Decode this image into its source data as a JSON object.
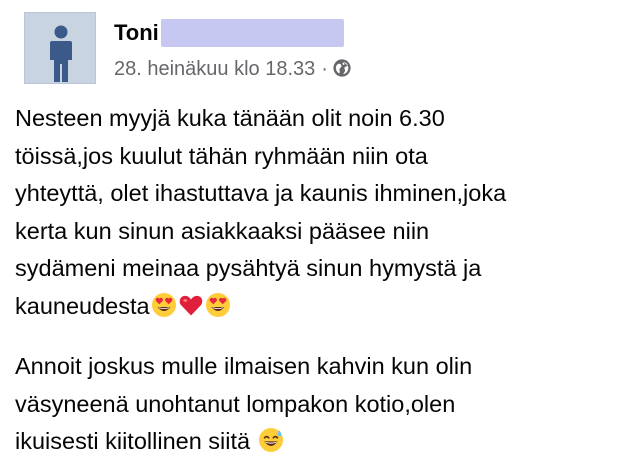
{
  "post": {
    "author_name": "Toni",
    "timestamp": "28. heinäkuu klo 18.33",
    "separator": "·",
    "audience_icon": "globe-icon",
    "paragraphs": [
      {
        "lines": [
          "Nesteen myyjä kuka tänään olit noin 6.30",
          "töissä,jos kuulut tähän ryhmään niin ota",
          "yhteyttä, olet ihastuttava ja kaunis ihminen,joka",
          "kerta kun sinun asiakkaaksi pääsee niin",
          "sydämeni meinaa pysähtyä sinun hymystä ja",
          "kauneudesta"
        ],
        "trailing_emoji": [
          "heart-eyes-emoji",
          "red-heart-emoji",
          "heart-eyes-emoji"
        ]
      },
      {
        "lines": [
          "Annoit joskus mulle ilmaisen kahvin kun olin",
          "väsyneenä unohtanut lompakon kotio,olen",
          "ikuisesti kiitollinen siitä "
        ],
        "trailing_emoji": [
          "sweat-smile-emoji"
        ]
      }
    ]
  },
  "colors": {
    "redaction": "#c7c8f2",
    "avatar_bg": "#c9d4e3",
    "avatar_figure": "#3b5a8a",
    "meta_text": "#65676b",
    "body_text": "#050505"
  }
}
